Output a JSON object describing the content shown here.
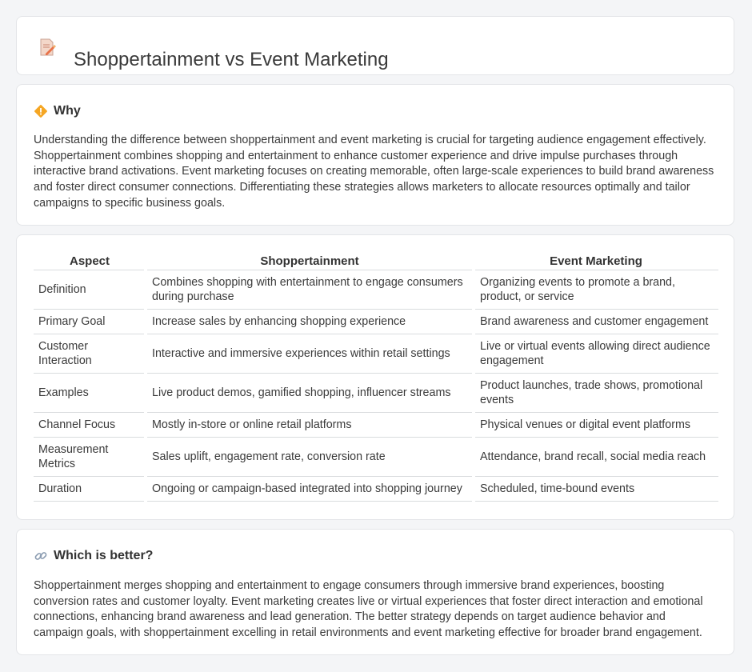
{
  "header": {
    "title": "Shoppertainment vs Event Marketing",
    "icon": "document-edit-icon"
  },
  "why": {
    "heading": "Why",
    "icon": "diamond-warning-icon",
    "text": "Understanding the difference between shoppertainment and event marketing is crucial for targeting audience engagement effectively. Shoppertainment combines shopping and entertainment to enhance customer experience and drive impulse purchases through interactive brand activations. Event marketing focuses on creating memorable, often large-scale experiences to build brand awareness and foster direct consumer connections. Differentiating these strategies allows marketers to allocate resources optimally and tailor campaigns to specific business goals."
  },
  "table": {
    "headers": [
      "Aspect",
      "Shoppertainment",
      "Event Marketing"
    ],
    "rows": [
      [
        "Definition",
        "Combines shopping with entertainment to engage consumers during purchase",
        "Organizing events to promote a brand, product, or service"
      ],
      [
        "Primary Goal",
        "Increase sales by enhancing shopping experience",
        "Brand awareness and customer engagement"
      ],
      [
        "Customer Interaction",
        "Interactive and immersive experiences within retail settings",
        "Live or virtual events allowing direct audience engagement"
      ],
      [
        "Examples",
        "Live product demos, gamified shopping, influencer streams",
        "Product launches, trade shows, promotional events"
      ],
      [
        "Channel Focus",
        "Mostly in-store or online retail platforms",
        "Physical venues or digital event platforms"
      ],
      [
        "Measurement Metrics",
        "Sales uplift, engagement rate, conversion rate",
        "Attendance, brand recall, social media reach"
      ],
      [
        "Duration",
        "Ongoing or campaign-based integrated into shopping journey",
        "Scheduled, time-bound events"
      ]
    ]
  },
  "better": {
    "heading": "Which is better?",
    "icon": "link-icon",
    "text": "Shoppertainment merges shopping and entertainment to engage consumers through immersive brand experiences, boosting conversion rates and customer loyalty. Event marketing creates live or virtual experiences that foster direct interaction and emotional connections, enhancing brand awareness and lead generation. The better strategy depends on target audience behavior and campaign goals, with shoppertainment excelling in retail environments and event marketing effective for broader brand engagement."
  }
}
